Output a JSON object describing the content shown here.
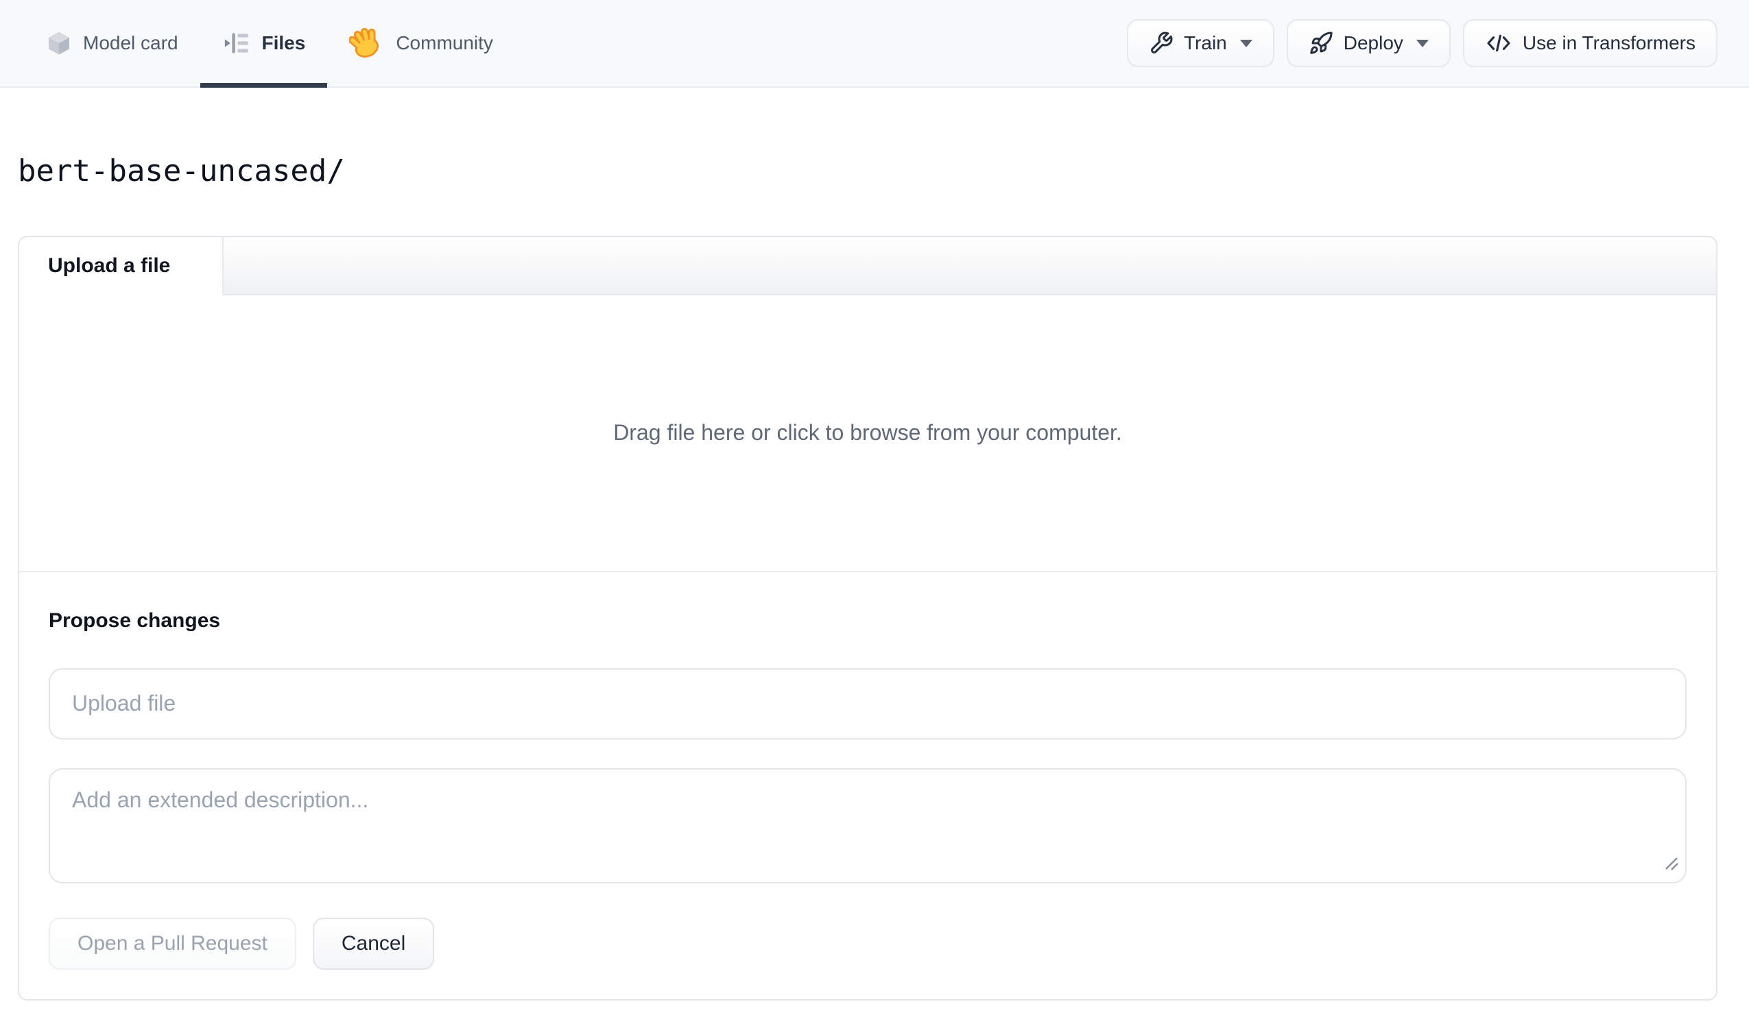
{
  "nav": {
    "tabs": [
      {
        "label": "Model card",
        "icon": "cube-icon",
        "active": false
      },
      {
        "label": "Files",
        "icon": "files-list-icon",
        "active": true
      },
      {
        "label": "Community",
        "icon": "waving-hand-icon",
        "active": false
      }
    ],
    "actions": [
      {
        "label": "Train",
        "icon": "wrench-icon",
        "has_dropdown": true
      },
      {
        "label": "Deploy",
        "icon": "rocket-icon",
        "has_dropdown": true
      },
      {
        "label": "Use in Transformers",
        "icon": "code-icon",
        "has_dropdown": false
      }
    ]
  },
  "repo": {
    "path": "bert-base-uncased/"
  },
  "upload_panel": {
    "active_tab": "Upload a file",
    "dropzone_text": "Drag file here or click to browse from your computer.",
    "propose_changes": {
      "heading": "Propose changes",
      "file_input_placeholder": "Upload file",
      "description_placeholder": "Add an extended description...",
      "buttons": {
        "open_pr": {
          "label": "Open a Pull Request",
          "enabled": false
        },
        "cancel": {
          "label": "Cancel",
          "enabled": true
        }
      }
    }
  },
  "colors": {
    "nav_bg": "#f8f9fb",
    "active_tab_underline": "#343d4d",
    "panel_border": "#e3e6ea",
    "tabbar_gradient_bottom": "#f0f1f3",
    "dropzone_text": "#5f6877",
    "placeholder_text": "#9aa3b1",
    "dark_text": "#1d2635",
    "disabled_text": "#9aa2ad",
    "hand_yellow": "#ffc93e",
    "hand_outline": "#ef9325"
  }
}
